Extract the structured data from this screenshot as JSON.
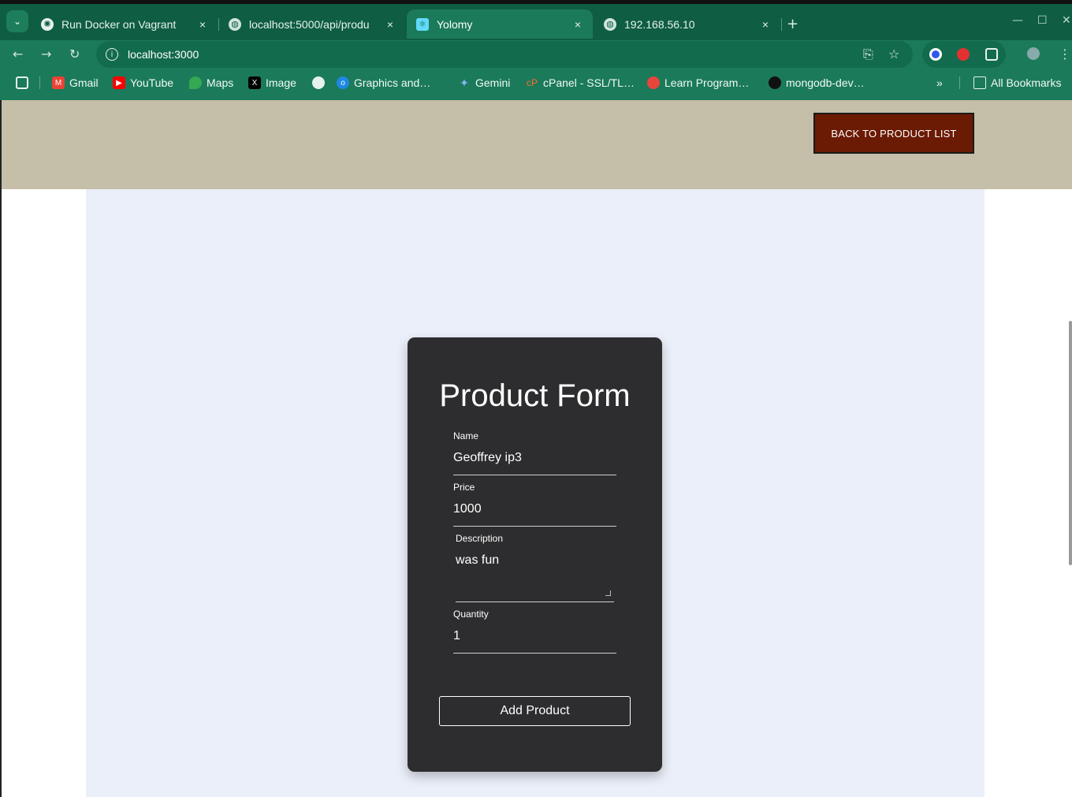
{
  "browser": {
    "tabs": [
      {
        "title": "Run Docker on Vagrant",
        "icon": "openai-icon"
      },
      {
        "title": "localhost:5000/api/produ",
        "icon": "globe-icon"
      },
      {
        "title": "Yolomy",
        "icon": "react-icon"
      },
      {
        "title": "192.168.56.10",
        "icon": "globe-icon"
      }
    ],
    "close_glyph": "×",
    "new_tab_glyph": "+",
    "url": "localhost:3000",
    "bookmarks": [
      "Gmail",
      "YouTube",
      "Maps",
      "Image",
      "Graphics and…",
      "Gemini",
      "cPanel - SSL/TL…",
      "Learn Program…",
      "mongodb-dev…"
    ],
    "more_bookmarks": "»",
    "all_bookmarks": "All Bookmarks"
  },
  "header": {
    "back_button": "BACK TO PRODUCT LIST"
  },
  "form": {
    "title": "Product Form",
    "fields": [
      {
        "label": "Name",
        "value": "Geoffrey ip3"
      },
      {
        "label": "Price",
        "value": "1000"
      },
      {
        "label": "Description",
        "value": "was fun"
      },
      {
        "label": "Quantity",
        "value": "1"
      }
    ],
    "submit": "Add Product"
  },
  "colors": {
    "chrome_green": "#1b7a5a",
    "header_band": "#c5bea8",
    "back_button_bg": "#6b1a04",
    "content_bg": "#ebeff9",
    "card_bg": "#2d2d2f"
  }
}
